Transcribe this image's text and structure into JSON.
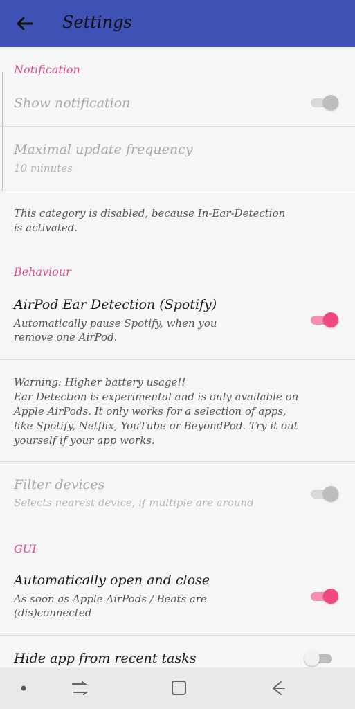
{
  "appbar": {
    "title": "Settings"
  },
  "notification": {
    "category": "Notification",
    "show_notification": {
      "title": "Show notification",
      "state": "disabled-on"
    },
    "max_update": {
      "title": "Maximal update frequency",
      "summary": "10 minutes"
    },
    "disabled_note": "This category is disabled, because In-Ear-Detection\nis activated."
  },
  "behaviour": {
    "category": "Behaviour",
    "ear_detection": {
      "title": "AirPod Ear Detection (Spotify)",
      "summary": "Automatically pause Spotify, when you remove one AirPod.",
      "state": "on"
    },
    "warning": "Warning: Higher battery usage!!\nEar Detection is experimental and is only available on\nApple AirPods. It only works for a selection of apps,\nlike Spotify, Netflix, YouTube or BeyondPod. Try it out\nyourself if your app works.",
    "filter_devices": {
      "title": "Filter devices",
      "summary": "Selects nearest device, if multiple are around",
      "state": "disabled-on"
    }
  },
  "gui": {
    "category": "GUI",
    "auto_open": {
      "title": "Automatically open and close",
      "summary": "As soon as Apple AirPods / Beats are (dis)connected",
      "state": "on"
    },
    "hide_app": {
      "title": "Hide app from recent tasks",
      "state": "off"
    }
  },
  "colors": {
    "appbar": "#3f51b5",
    "accent": "#f0487f",
    "category": "#e24c8e"
  }
}
